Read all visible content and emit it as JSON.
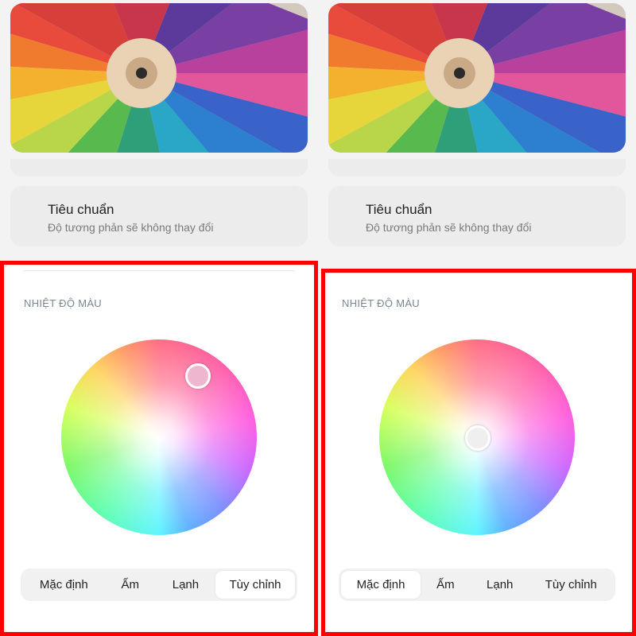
{
  "panels": {
    "left": {
      "standard": {
        "title": "Tiêu chuẩn",
        "subtitle": "Độ tương phản sẽ không thay đổi"
      },
      "section_label": "NHIỆT ĐỘ MÀU",
      "tabs": [
        "Mặc định",
        "Ấm",
        "Lạnh",
        "Tùy chỉnh"
      ],
      "selected_tab": "Tùy chỉnh"
    },
    "right": {
      "standard": {
        "title": "Tiêu chuẩn",
        "subtitle": "Độ tương phản sẽ không thay đổi"
      },
      "section_label": "NHIỆT ĐỘ MÀU",
      "tabs": [
        "Mặc định",
        "Ấm",
        "Lạnh",
        "Tùy chỉnh"
      ],
      "selected_tab": "Mặc định"
    }
  },
  "colors": {
    "highlight_border": "#ff0000",
    "card_bg": "#ececec",
    "wheel_handle_left": "#eeb7cf"
  }
}
